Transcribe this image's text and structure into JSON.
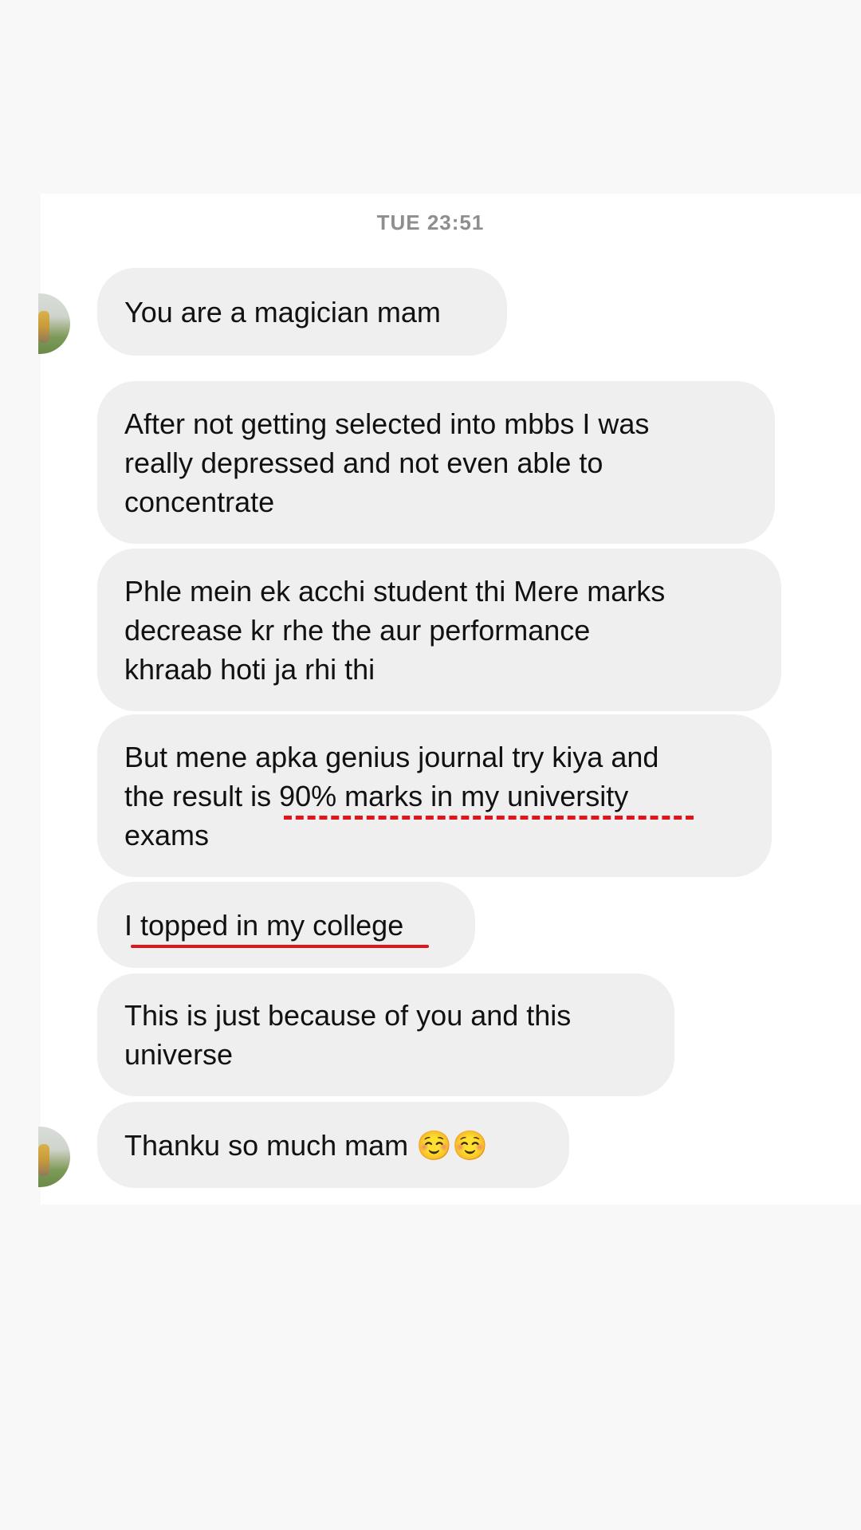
{
  "conversation": {
    "timestamp": "TUE 23:51",
    "messages": [
      {
        "text": "You are a magician mam"
      },
      {
        "text": "After not getting selected into mbbs I was\nreally depressed and not even able to\nconcentrate"
      },
      {
        "text": "Phle mein ek acchi student thi Mere marks\ndecrease kr rhe the aur performance\nkhraab hoti ja rhi thi"
      },
      {
        "text": "But mene apka genius journal try kiya and\nthe result is 90% marks in my university\nexams"
      },
      {
        "text": "I topped in my college"
      },
      {
        "text": "This is just because of you and this\nuniverse"
      },
      {
        "text": "Thanku so much mam ☺️☺️"
      }
    ]
  },
  "colors": {
    "bubble": "#efefef",
    "annotation": "#e0141b",
    "timestamp": "#8e8e8e"
  }
}
